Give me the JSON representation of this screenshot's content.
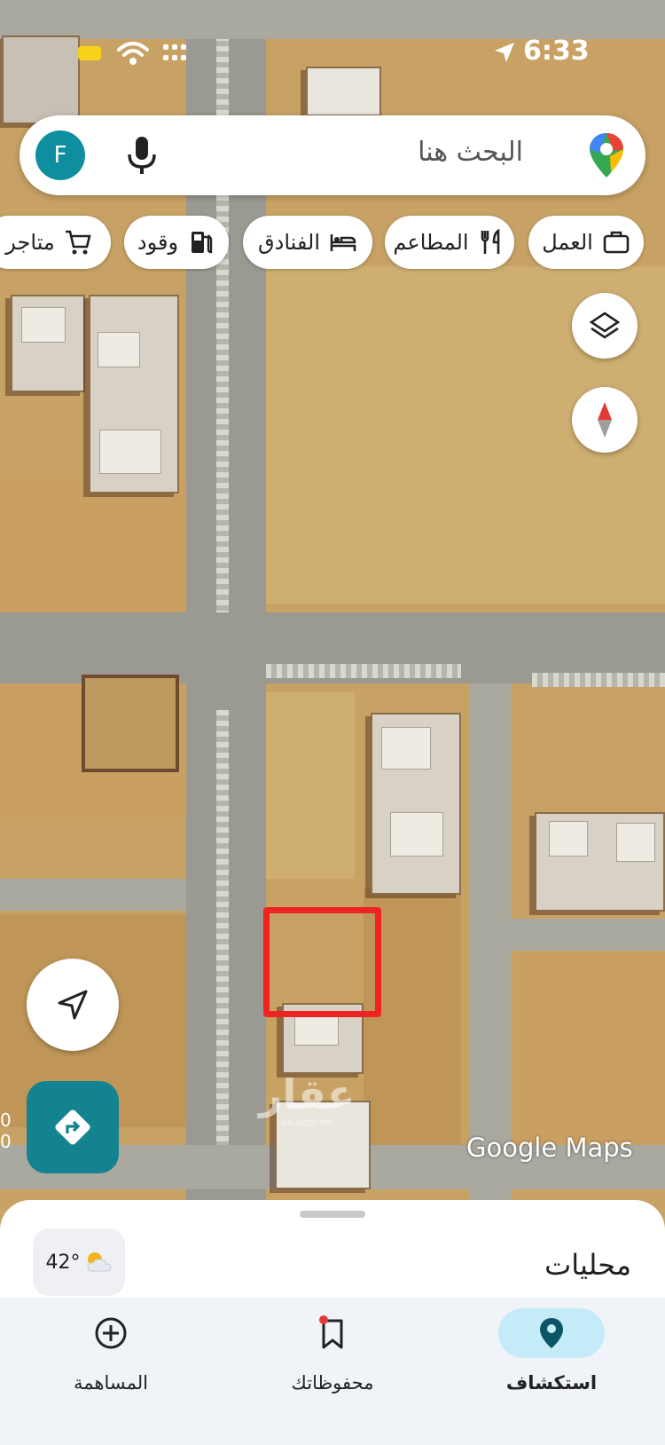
{
  "status_bar": {
    "time": "6:33",
    "battery_color": "#f7d21a",
    "icons": [
      "battery-icon",
      "wifi-icon",
      "signal-dots-icon",
      "location-arrow-icon"
    ]
  },
  "search": {
    "avatar_letter": "F",
    "avatar_color": "#0f8ea0",
    "placeholder": "البحث هنا",
    "icons": [
      "mic-icon",
      "maps-pin-icon"
    ]
  },
  "chips": [
    {
      "label": "العمل",
      "icon": "briefcase-icon"
    },
    {
      "label": "المطاعم",
      "icon": "fork-knife-icon"
    },
    {
      "label": "الفنادق",
      "icon": "bed-icon"
    },
    {
      "label": "وقود",
      "icon": "gas-pump-icon"
    },
    {
      "label": "متاجر ا",
      "icon": "cart-icon"
    }
  ],
  "map": {
    "attribution": "Google Maps",
    "watermark": "عقار",
    "watermark_sub": "sa.aqar.fm",
    "scale_labels": [
      "0",
      "0"
    ],
    "marker_color": "#ef2323"
  },
  "bottom_sheet": {
    "title": "محليات",
    "temperature": "42°",
    "weather_icon": "sun-cloud-icon"
  },
  "nav": {
    "items": [
      {
        "label": "استكشاف",
        "icon": "location-pin-icon",
        "active": true
      },
      {
        "label": "محفوظاتك",
        "icon": "bookmark-icon",
        "active": false
      },
      {
        "label": "المساهمة",
        "icon": "add-circle-icon",
        "active": false
      }
    ],
    "active_color": "#c4ecf8"
  }
}
